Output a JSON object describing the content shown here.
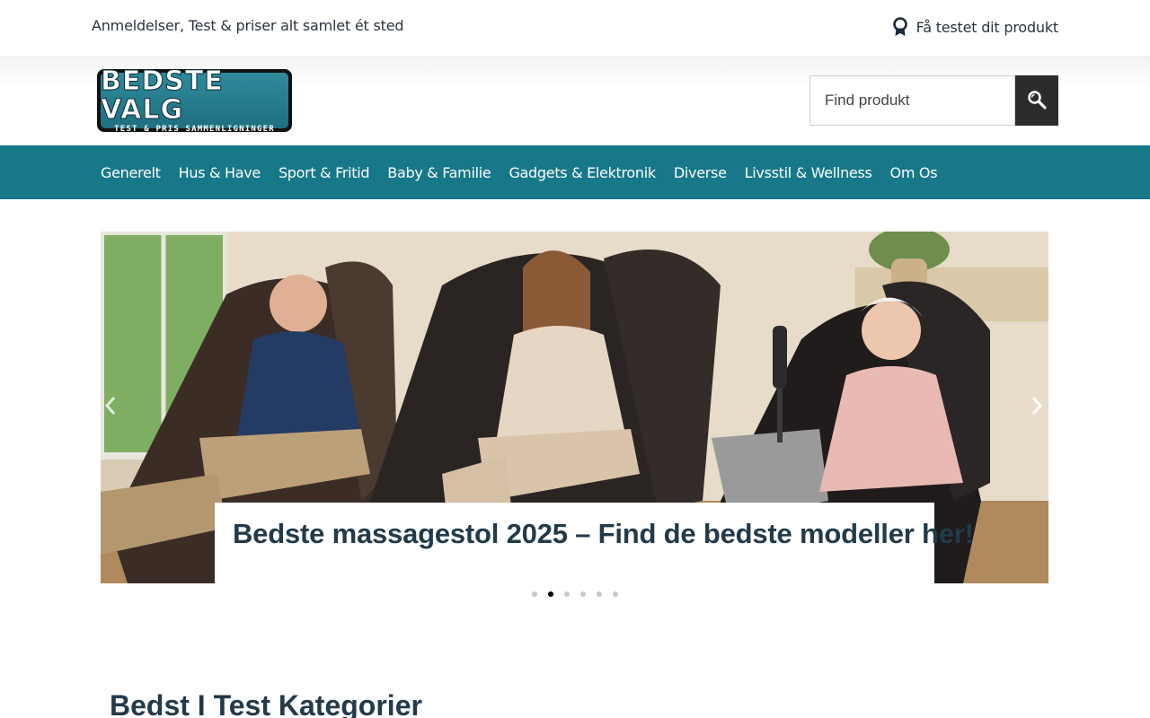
{
  "topbar": {
    "tagline": "Anmeldelser, Test & priser alt samlet ét sted",
    "test_link": "Få testet dit produkt",
    "test_icon": "award-ribbon-icon"
  },
  "logo": {
    "main": "BEDSTE VALG",
    "sub": "TEST & PRIS SAMMENLIGNINGER"
  },
  "search": {
    "placeholder": "Find produkt",
    "button_icon": "search-icon"
  },
  "nav": {
    "items": [
      {
        "label": "Generelt"
      },
      {
        "label": "Hus & Have"
      },
      {
        "label": "Sport & Fritid"
      },
      {
        "label": "Baby & Familie"
      },
      {
        "label": "Gadgets & Elektronik"
      },
      {
        "label": "Diverse"
      },
      {
        "label": "Livsstil & Wellness"
      },
      {
        "label": "Om Os"
      }
    ]
  },
  "slider": {
    "caption": "Bedste massagestol 2025 – Find de bedste modeller her!",
    "slide_count": 6,
    "active_slide": 2,
    "prev_icon": "chevron-left-icon",
    "next_icon": "chevron-right-icon"
  },
  "section": {
    "title": "Bedst I Test Kategorier"
  },
  "colors": {
    "nav_bg": "#177889",
    "heading": "#233a4a",
    "search_button": "#2c2c2c"
  }
}
